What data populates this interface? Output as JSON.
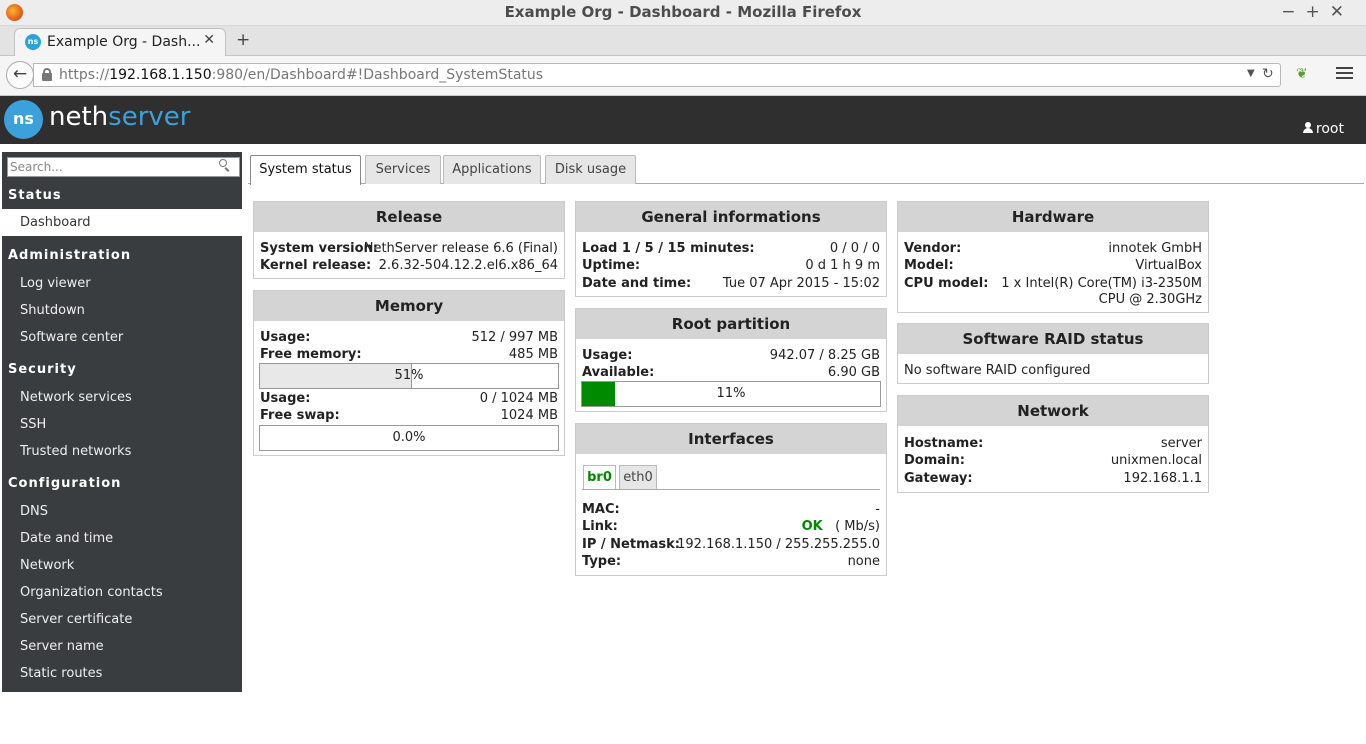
{
  "window": {
    "title": "Example Org - Dashboard - Mozilla Firefox"
  },
  "browser": {
    "tab_title": "Example Org - Dash...",
    "url_scheme": "https://",
    "url_host": "192.168.1.150",
    "url_rest": ":980/en/Dashboard#!Dashboard_SystemStatus"
  },
  "header": {
    "logo_text": "ns",
    "brand_1": "neth",
    "brand_2": "server",
    "user": "root"
  },
  "sidebar": {
    "search_placeholder": "Search...",
    "sections": [
      {
        "title": "Status",
        "items": [
          "Dashboard"
        ]
      },
      {
        "title": "Administration",
        "items": [
          "Log viewer",
          "Shutdown",
          "Software center"
        ]
      },
      {
        "title": "Security",
        "items": [
          "Network services",
          "SSH",
          "Trusted networks"
        ]
      },
      {
        "title": "Configuration",
        "items": [
          "DNS",
          "Date and time",
          "Network",
          "Organization contacts",
          "Server certificate",
          "Server name",
          "Static routes"
        ]
      }
    ]
  },
  "tabs": [
    "System status",
    "Services",
    "Applications",
    "Disk usage"
  ],
  "release": {
    "title": "Release",
    "system_version_label": "System version:",
    "system_version": "NethServer release 6.6 (Final)",
    "kernel_label": "Kernel release:",
    "kernel": "2.6.32-504.12.2.el6.x86_64"
  },
  "memory": {
    "title": "Memory",
    "usage_label": "Usage:",
    "usage": "512 / 997 MB",
    "free_label": "Free memory:",
    "free": "485 MB",
    "mem_percent_text": "51%",
    "mem_percent": 51,
    "swap_usage_label": "Usage:",
    "swap_usage": "0 / 1024 MB",
    "free_swap_label": "Free swap:",
    "free_swap": "1024 MB",
    "swap_percent_text": "0.0%",
    "swap_percent": 0
  },
  "general": {
    "title": "General informations",
    "load_label": "Load 1 / 5 / 15 minutes:",
    "load": "0 / 0 / 0",
    "uptime_label": "Uptime:",
    "uptime": "0 d 1 h 9 m",
    "datetime_label": "Date and time:",
    "datetime": "Tue 07 Apr 2015 - 15:02"
  },
  "root_partition": {
    "title": "Root partition",
    "usage_label": "Usage:",
    "usage": "942.07 / 8.25 GB",
    "available_label": "Available:",
    "available": "6.90 GB",
    "percent_text": "11%",
    "percent": 11
  },
  "interfaces": {
    "title": "Interfaces",
    "tabs": [
      "br0",
      "eth0"
    ],
    "mac_label": "MAC:",
    "mac": "-",
    "link_label": "Link:",
    "link_status": "OK",
    "link_speed": "( Mb/s)",
    "ip_label": "IP / Netmask:",
    "ip": "192.168.1.150 / 255.255.255.0",
    "type_label": "Type:",
    "type": "none"
  },
  "hardware": {
    "title": "Hardware",
    "vendor_label": "Vendor:",
    "vendor": "innotek GmbH",
    "model_label": "Model:",
    "model": "VirtualBox",
    "cpu_label": "CPU model:",
    "cpu_line1": "1 x Intel(R) Core(TM) i3-2350M",
    "cpu_line2": "CPU @ 2.30GHz"
  },
  "raid": {
    "title": "Software RAID status",
    "status": "No software RAID configured"
  },
  "network": {
    "title": "Network",
    "hostname_label": "Hostname:",
    "hostname": "server",
    "domain_label": "Domain:",
    "domain": "unixmen.local",
    "gateway_label": "Gateway:",
    "gateway": "192.168.1.1"
  },
  "colors": {
    "accent": "#3ba1db",
    "progress_green": "#008a00",
    "ok_green": "#008a00",
    "sidebar_bg": "#3a3d3f"
  }
}
